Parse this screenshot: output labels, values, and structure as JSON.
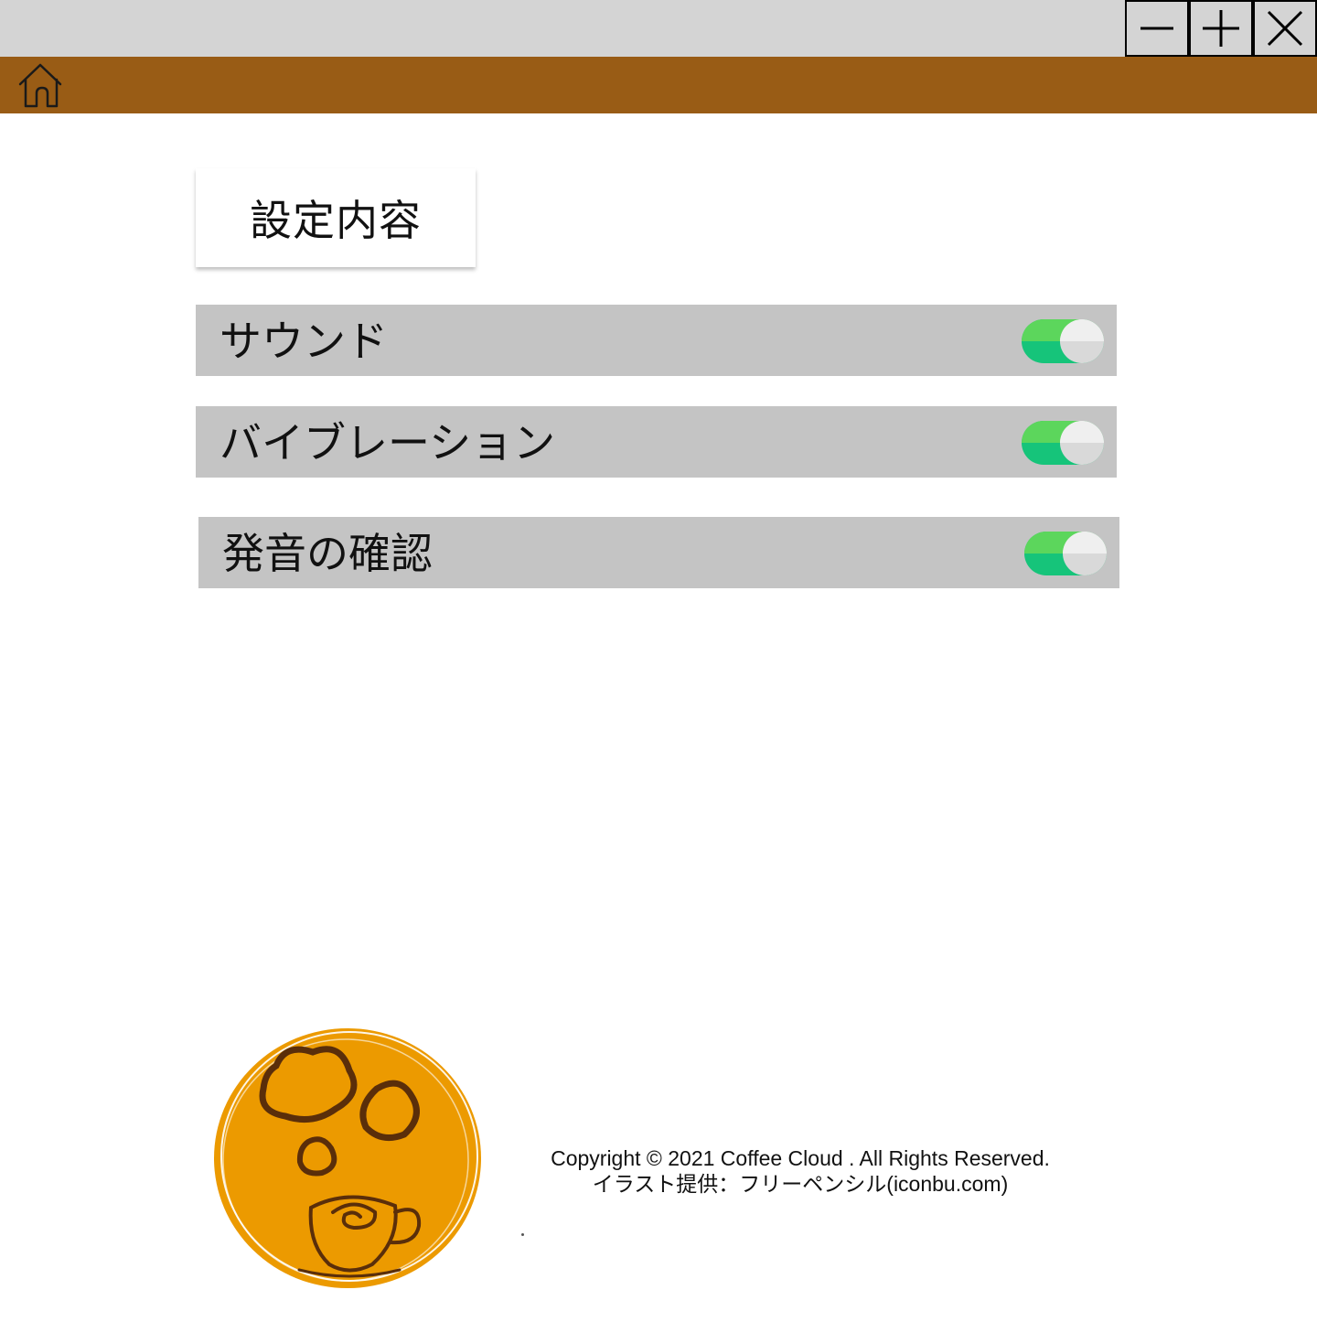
{
  "window": {
    "controls": [
      {
        "name": "minimize",
        "icon": "minus-icon"
      },
      {
        "name": "maximize",
        "icon": "plus-icon"
      },
      {
        "name": "close",
        "icon": "close-icon"
      }
    ]
  },
  "header": {
    "home_icon": "home-icon",
    "background_color": "#995c15"
  },
  "section": {
    "title": "設定内容"
  },
  "settings": [
    {
      "label": "サウンド",
      "enabled": true
    },
    {
      "label": "バイブレーション",
      "enabled": true
    },
    {
      "label": "発音の確認",
      "enabled": true
    }
  ],
  "colors": {
    "row_bg": "#c4c4c4",
    "toggle_on_top": "#5cd65c",
    "toggle_on_bottom": "#16c47a",
    "logo": "#ec9a00"
  },
  "footer": {
    "copyright": "Copyright © 2021 Coffee Cloud . All Rights Reserved.",
    "credit": "イラスト提供：フリーペンシル(iconbu.com)"
  }
}
